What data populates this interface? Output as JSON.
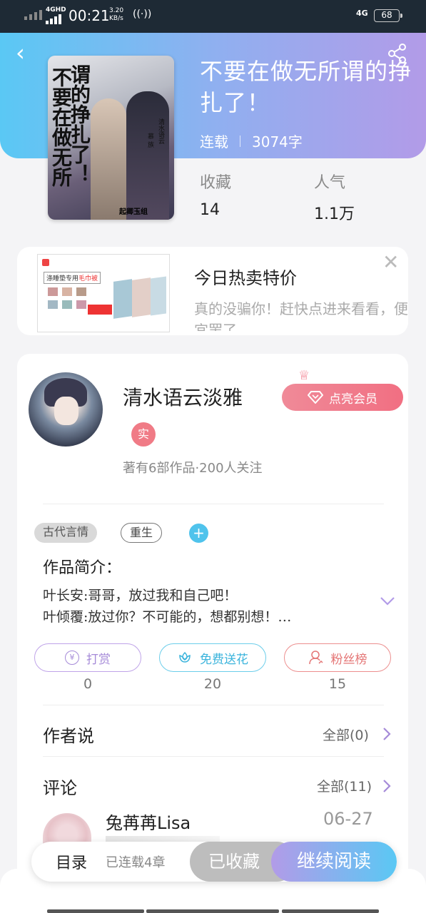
{
  "status_bar": {
    "network": "4GHD",
    "time": "00:21",
    "speed_value": "3.20",
    "speed_unit": "KB/s",
    "network2": "4G",
    "battery": "68"
  },
  "book": {
    "title": "不要在做无所谓的挣扎了！",
    "status": "连载",
    "word_count": "3074字",
    "stats": [
      {
        "label": "收藏",
        "value": "14"
      },
      {
        "label": "人气",
        "value": "1.1万"
      }
    ],
    "cover": {
      "title_col1": "谓的挣扎了！",
      "title_col2": "不要在做无所",
      "sub1": "清水语云",
      "sub2": "慕 族",
      "sign": "起卿玉组"
    }
  },
  "ad": {
    "title": "今日热卖特价",
    "description": "真的没骗你！赶快点进来看看，便宜罢了",
    "image_tag_prefix": "涤睡垫专用",
    "image_tag_highlight": "毛巾被"
  },
  "author": {
    "name": "清水语云淡雅",
    "vip_label": "点亮会员",
    "real_badge": "实",
    "stats": "著有6部作品·200人关注"
  },
  "tags": [
    "古代言情",
    "重生"
  ],
  "tag_add": "+",
  "intro": {
    "label": "作品简介：",
    "line1": "叶长安:哥哥，放过我和自己吧！",
    "line2": "叶倾覆:放过你？不可能的，想都别想！…"
  },
  "actions": [
    {
      "label": "打赏",
      "count": "0"
    },
    {
      "label": "免费送花",
      "count": "20"
    },
    {
      "label": "粉丝榜",
      "count": "15"
    }
  ],
  "author_says": {
    "title": "作者说",
    "more": "全部(0)"
  },
  "comments": {
    "title": "评论",
    "more": "全部(11)",
    "items": [
      {
        "user": "兔苒苒Lisa",
        "date": "06-27"
      }
    ]
  },
  "bottom_bar": {
    "toc_label": "目录",
    "toc_status": "已连载4章",
    "favorited": "已收藏",
    "continue_read": "继续阅读"
  },
  "colors": {
    "hero_start": "#5ac8f4",
    "hero_end": "#b29be8",
    "vip": "#f16f82",
    "accent_blue": "#4fc3ec"
  }
}
